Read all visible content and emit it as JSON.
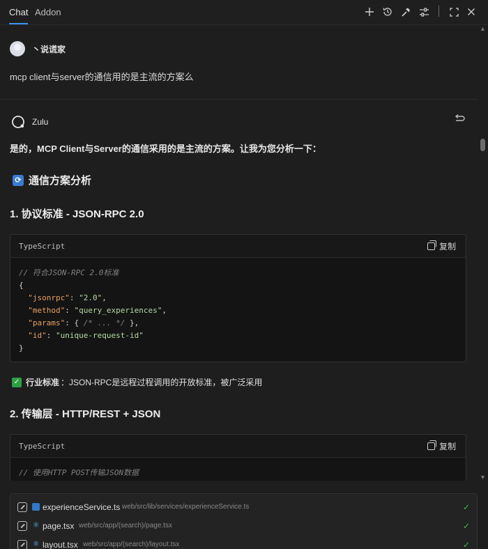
{
  "header": {
    "tabs": [
      {
        "label": "Chat"
      },
      {
        "label": "Addon"
      }
    ],
    "icons": [
      "plus-icon",
      "history-icon",
      "hammer-icon",
      "settings-sliders-icon",
      "expand-icon",
      "close-icon"
    ]
  },
  "user": {
    "name": "丶说谎家",
    "message": "mcp client与server的通信用的是主流的方案么"
  },
  "assistant": {
    "name": "Zulu",
    "intro": "是的，MCP Client与Server的通信采用的是主流的方案。让我为您分析一下：",
    "heading": "通信方案分析",
    "section1": "1. 协议标准 - JSON-RPC 2.0",
    "code1": {
      "lang": "TypeScript",
      "copy": "复制",
      "lines": {
        "comment": "// 符合JSON-RPC 2.0标准",
        "open": "{",
        "k1": "\"jsonrpc\"",
        "v1": "\"2.0\"",
        "k2": "\"method\"",
        "v2": "\"query_experiences\"",
        "k3": "\"params\"",
        "v3_open": "{ ",
        "v3_comment": "/* ... */",
        "v3_close": " },",
        "k4": "\"id\"",
        "v4": "\"unique-request-id\"",
        "close": "}"
      }
    },
    "note_bold": "行业标准",
    "note_text": "：JSON-RPC是远程过程调用的开放标准，被广泛采用",
    "section2": "2. 传输层 - HTTP/REST + JSON",
    "code2": {
      "lang": "TypeScript",
      "copy": "复制",
      "comment": "// 使用HTTP POST传输JSON数据"
    }
  },
  "files": [
    {
      "name": "experienceService.ts",
      "path": "web/src/lib/services/experienceService.ts",
      "type": "ts"
    },
    {
      "name": "page.tsx",
      "path": "web/src/app/(search)/page.tsx",
      "type": "tsx"
    },
    {
      "name": "layout.tsx",
      "path": "web/src/app/(search)/layout.tsx",
      "type": "tsx"
    }
  ],
  "colors": {
    "accent": "#3794ff",
    "success": "#3fb950",
    "background": "#1e1e1e"
  }
}
